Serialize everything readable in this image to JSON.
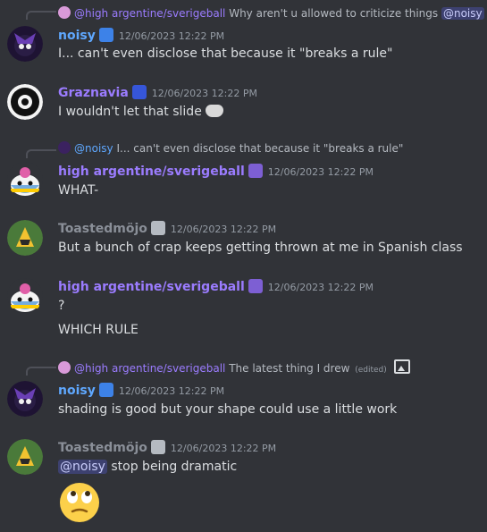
{
  "colors": {
    "background": "#313338",
    "name_blue": "#5fa8ff",
    "name_purple": "#9b7cff",
    "name_gray": "#8a8f98",
    "mention_bg": "rgba(88,101,242,0.3)"
  },
  "messages": [
    {
      "reply": {
        "author": "@high argentine/sverigeball",
        "text": "Why aren't u allowed to criticize things",
        "mention": "@noisy"
      },
      "author": "noisy",
      "timestamp": "12/06/2023 12:22 PM",
      "lines": [
        "I... can't even disclose that because it \"breaks a rule\""
      ],
      "avatar": "dark-purple-avatar"
    },
    {
      "author": "Graznavia",
      "timestamp": "12/06/2023 12:22 PM",
      "lines": [
        "I wouldn't let that slide"
      ],
      "emoji": "trollface",
      "avatar": "round-emblem-avatar"
    },
    {
      "reply": {
        "author": "@noisy",
        "text": "I... can't even disclose that because it \"breaks a rule\""
      },
      "author": "high argentine/sverigeball",
      "timestamp": "12/06/2023 12:22 PM",
      "lines": [
        "WHAT-"
      ],
      "avatar": "countryball-avatar"
    },
    {
      "author": "Toastedmöjo",
      "timestamp": "12/06/2023 12:22 PM",
      "lines": [
        "But a bunch of crap keeps getting thrown at me in Spanish class"
      ],
      "avatar": "yellow-green-avatar"
    },
    {
      "author": "high argentine/sverigeball",
      "timestamp": "12/06/2023 12:22 PM",
      "lines": [
        "?",
        "WHICH RULE"
      ],
      "avatar": "countryball-avatar"
    },
    {
      "reply": {
        "author": "@high argentine/sverigeball",
        "text": "The latest thing I drew",
        "edited": "(edited)"
      },
      "author": "noisy",
      "timestamp": "12/06/2023 12:22 PM",
      "lines": [
        "shading is good but your shape could use a little work"
      ],
      "avatar": "dark-purple-avatar"
    },
    {
      "author": "Toastedmöjo",
      "timestamp": "12/06/2023 12:22 PM",
      "mention": "@noisy",
      "lines": [
        "stop being dramatic"
      ],
      "emoji": "face-with-rolling-eyes",
      "avatar": "yellow-green-avatar"
    }
  ]
}
